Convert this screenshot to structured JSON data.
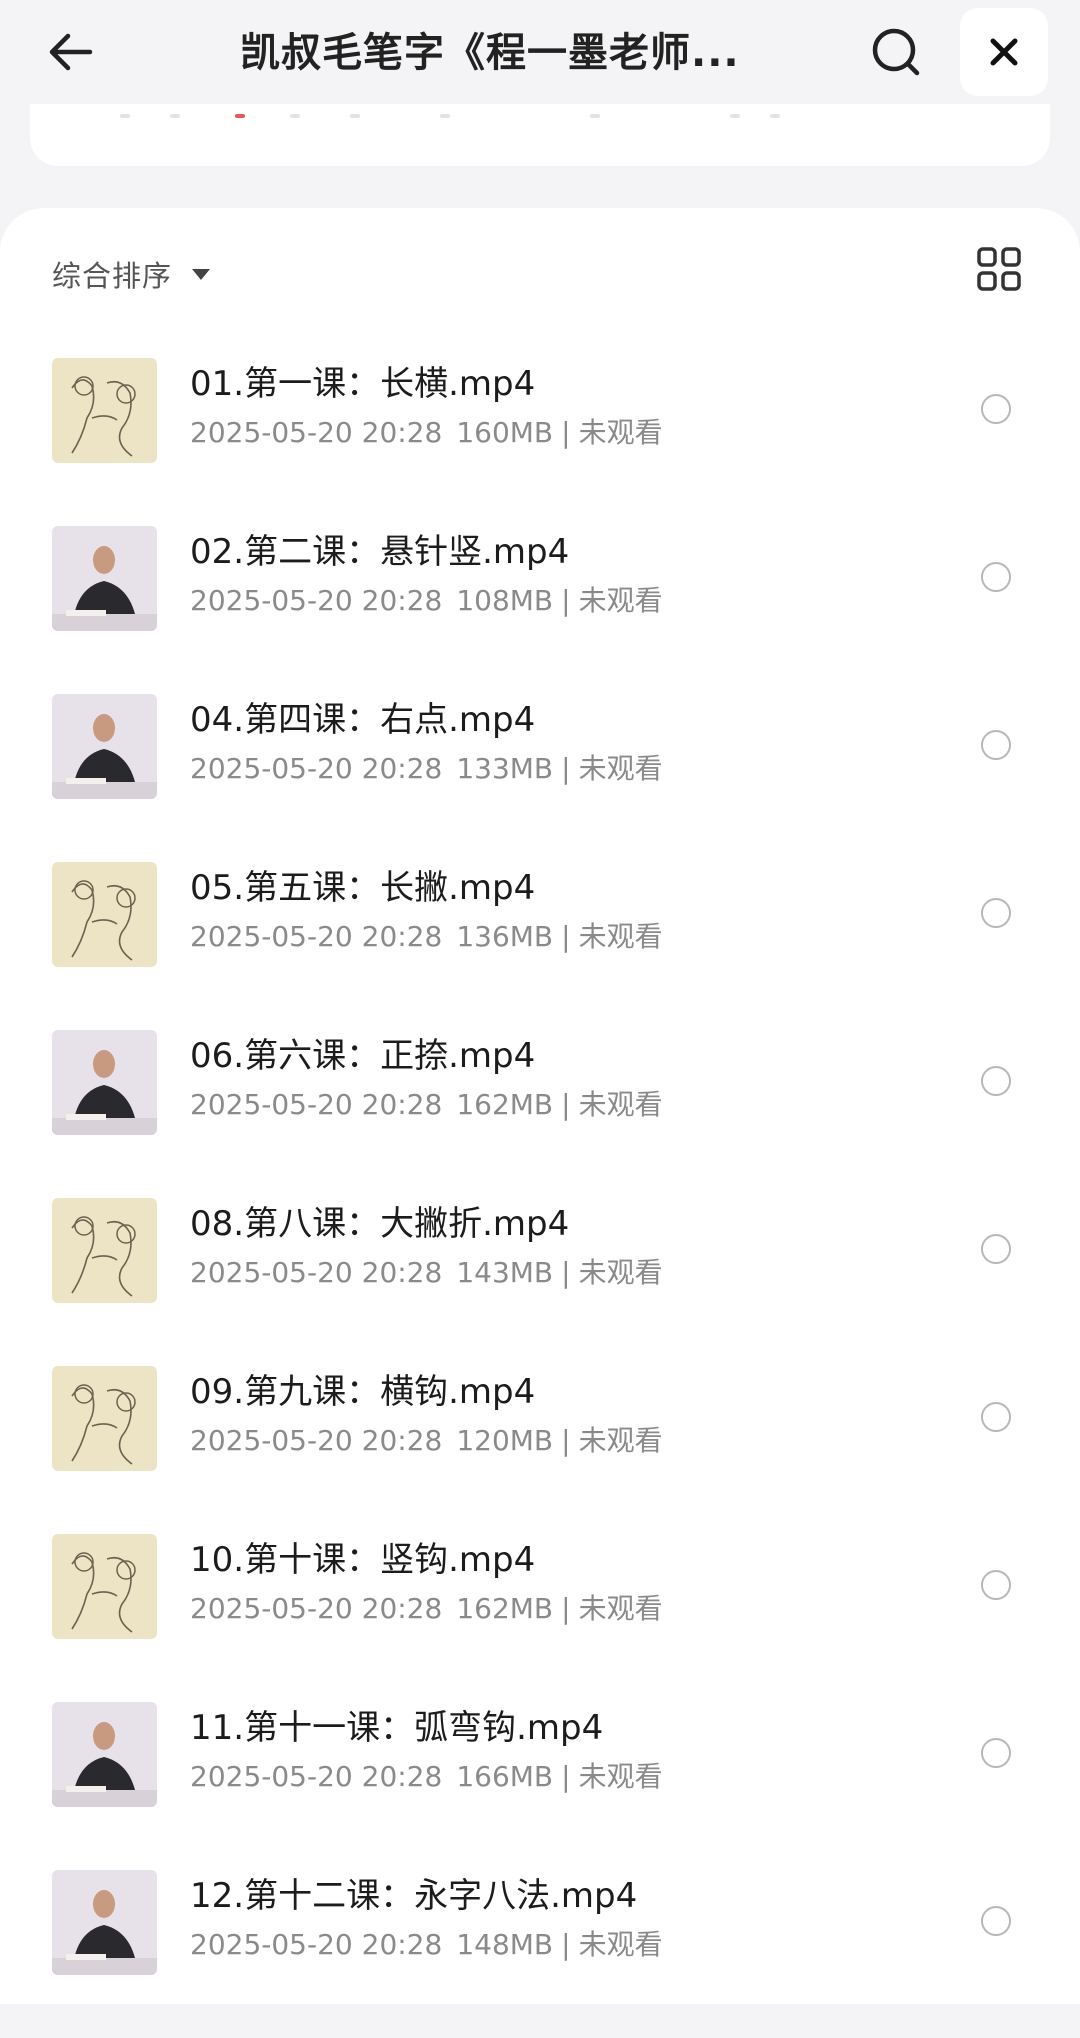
{
  "header": {
    "title": "凯叔毛笔字《程一墨老师...",
    "back_icon": "arrow-left-icon",
    "search_icon": "search-icon",
    "close_icon": "close-icon"
  },
  "sort": {
    "label": "综合排序",
    "caret_icon": "caret-down-icon",
    "view_icon": "grid-view-icon"
  },
  "files": [
    {
      "name": "01.第一课：长横.mp4",
      "date": "2025-05-20 20:28",
      "size": "160MB",
      "status": "未观看",
      "thumb": "sketch"
    },
    {
      "name": "02.第二课：悬针竖.mp4",
      "date": "2025-05-20 20:28",
      "size": "108MB",
      "status": "未观看",
      "thumb": "photo"
    },
    {
      "name": "04.第四课：右点.mp4",
      "date": "2025-05-20 20:28",
      "size": "133MB",
      "status": "未观看",
      "thumb": "photo"
    },
    {
      "name": "05.第五课：长撇.mp4",
      "date": "2025-05-20 20:28",
      "size": "136MB",
      "status": "未观看",
      "thumb": "sketch"
    },
    {
      "name": "06.第六课：正捺.mp4",
      "date": "2025-05-20 20:28",
      "size": "162MB",
      "status": "未观看",
      "thumb": "photo"
    },
    {
      "name": "08.第八课：大撇折.mp4",
      "date": "2025-05-20 20:28",
      "size": "143MB",
      "status": "未观看",
      "thumb": "sketch"
    },
    {
      "name": "09.第九课：横钩.mp4",
      "date": "2025-05-20 20:28",
      "size": "120MB",
      "status": "未观看",
      "thumb": "sketch"
    },
    {
      "name": "10.第十课：竖钩.mp4",
      "date": "2025-05-20 20:28",
      "size": "162MB",
      "status": "未观看",
      "thumb": "sketch"
    },
    {
      "name": "11.第十一课：弧弯钩.mp4",
      "date": "2025-05-20 20:28",
      "size": "166MB",
      "status": "未观看",
      "thumb": "photo"
    },
    {
      "name": "12.第十二课：永字八法.mp4",
      "date": "2025-05-20 20:28",
      "size": "148MB",
      "status": "未观看",
      "thumb": "photo"
    }
  ],
  "colors": {
    "background": "#f4f4f6",
    "panel": "#ffffff",
    "text_primary": "#1c1c1c",
    "text_secondary": "#8a8a8a",
    "sketch_thumb": "#ece4c4",
    "photo_thumb": "#e9e4ea"
  }
}
